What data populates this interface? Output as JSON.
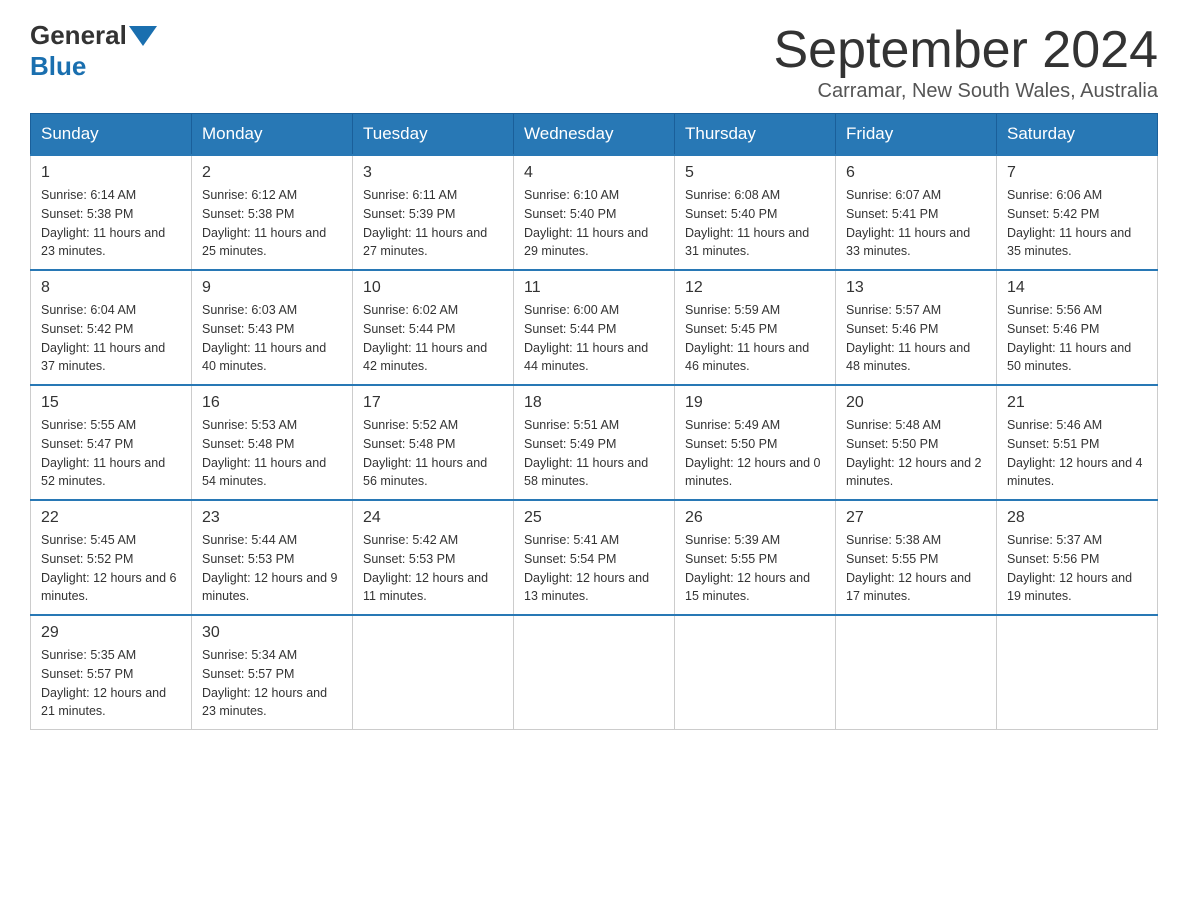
{
  "header": {
    "logo_general": "General",
    "logo_blue": "Blue",
    "month_year": "September 2024",
    "location": "Carramar, New South Wales, Australia"
  },
  "weekdays": [
    "Sunday",
    "Monday",
    "Tuesday",
    "Wednesday",
    "Thursday",
    "Friday",
    "Saturday"
  ],
  "weeks": [
    [
      {
        "day": "1",
        "sunrise": "6:14 AM",
        "sunset": "5:38 PM",
        "daylight": "11 hours and 23 minutes."
      },
      {
        "day": "2",
        "sunrise": "6:12 AM",
        "sunset": "5:38 PM",
        "daylight": "11 hours and 25 minutes."
      },
      {
        "day": "3",
        "sunrise": "6:11 AM",
        "sunset": "5:39 PM",
        "daylight": "11 hours and 27 minutes."
      },
      {
        "day": "4",
        "sunrise": "6:10 AM",
        "sunset": "5:40 PM",
        "daylight": "11 hours and 29 minutes."
      },
      {
        "day": "5",
        "sunrise": "6:08 AM",
        "sunset": "5:40 PM",
        "daylight": "11 hours and 31 minutes."
      },
      {
        "day": "6",
        "sunrise": "6:07 AM",
        "sunset": "5:41 PM",
        "daylight": "11 hours and 33 minutes."
      },
      {
        "day": "7",
        "sunrise": "6:06 AM",
        "sunset": "5:42 PM",
        "daylight": "11 hours and 35 minutes."
      }
    ],
    [
      {
        "day": "8",
        "sunrise": "6:04 AM",
        "sunset": "5:42 PM",
        "daylight": "11 hours and 37 minutes."
      },
      {
        "day": "9",
        "sunrise": "6:03 AM",
        "sunset": "5:43 PM",
        "daylight": "11 hours and 40 minutes."
      },
      {
        "day": "10",
        "sunrise": "6:02 AM",
        "sunset": "5:44 PM",
        "daylight": "11 hours and 42 minutes."
      },
      {
        "day": "11",
        "sunrise": "6:00 AM",
        "sunset": "5:44 PM",
        "daylight": "11 hours and 44 minutes."
      },
      {
        "day": "12",
        "sunrise": "5:59 AM",
        "sunset": "5:45 PM",
        "daylight": "11 hours and 46 minutes."
      },
      {
        "day": "13",
        "sunrise": "5:57 AM",
        "sunset": "5:46 PM",
        "daylight": "11 hours and 48 minutes."
      },
      {
        "day": "14",
        "sunrise": "5:56 AM",
        "sunset": "5:46 PM",
        "daylight": "11 hours and 50 minutes."
      }
    ],
    [
      {
        "day": "15",
        "sunrise": "5:55 AM",
        "sunset": "5:47 PM",
        "daylight": "11 hours and 52 minutes."
      },
      {
        "day": "16",
        "sunrise": "5:53 AM",
        "sunset": "5:48 PM",
        "daylight": "11 hours and 54 minutes."
      },
      {
        "day": "17",
        "sunrise": "5:52 AM",
        "sunset": "5:48 PM",
        "daylight": "11 hours and 56 minutes."
      },
      {
        "day": "18",
        "sunrise": "5:51 AM",
        "sunset": "5:49 PM",
        "daylight": "11 hours and 58 minutes."
      },
      {
        "day": "19",
        "sunrise": "5:49 AM",
        "sunset": "5:50 PM",
        "daylight": "12 hours and 0 minutes."
      },
      {
        "day": "20",
        "sunrise": "5:48 AM",
        "sunset": "5:50 PM",
        "daylight": "12 hours and 2 minutes."
      },
      {
        "day": "21",
        "sunrise": "5:46 AM",
        "sunset": "5:51 PM",
        "daylight": "12 hours and 4 minutes."
      }
    ],
    [
      {
        "day": "22",
        "sunrise": "5:45 AM",
        "sunset": "5:52 PM",
        "daylight": "12 hours and 6 minutes."
      },
      {
        "day": "23",
        "sunrise": "5:44 AM",
        "sunset": "5:53 PM",
        "daylight": "12 hours and 9 minutes."
      },
      {
        "day": "24",
        "sunrise": "5:42 AM",
        "sunset": "5:53 PM",
        "daylight": "12 hours and 11 minutes."
      },
      {
        "day": "25",
        "sunrise": "5:41 AM",
        "sunset": "5:54 PM",
        "daylight": "12 hours and 13 minutes."
      },
      {
        "day": "26",
        "sunrise": "5:39 AM",
        "sunset": "5:55 PM",
        "daylight": "12 hours and 15 minutes."
      },
      {
        "day": "27",
        "sunrise": "5:38 AM",
        "sunset": "5:55 PM",
        "daylight": "12 hours and 17 minutes."
      },
      {
        "day": "28",
        "sunrise": "5:37 AM",
        "sunset": "5:56 PM",
        "daylight": "12 hours and 19 minutes."
      }
    ],
    [
      {
        "day": "29",
        "sunrise": "5:35 AM",
        "sunset": "5:57 PM",
        "daylight": "12 hours and 21 minutes."
      },
      {
        "day": "30",
        "sunrise": "5:34 AM",
        "sunset": "5:57 PM",
        "daylight": "12 hours and 23 minutes."
      },
      null,
      null,
      null,
      null,
      null
    ]
  ]
}
